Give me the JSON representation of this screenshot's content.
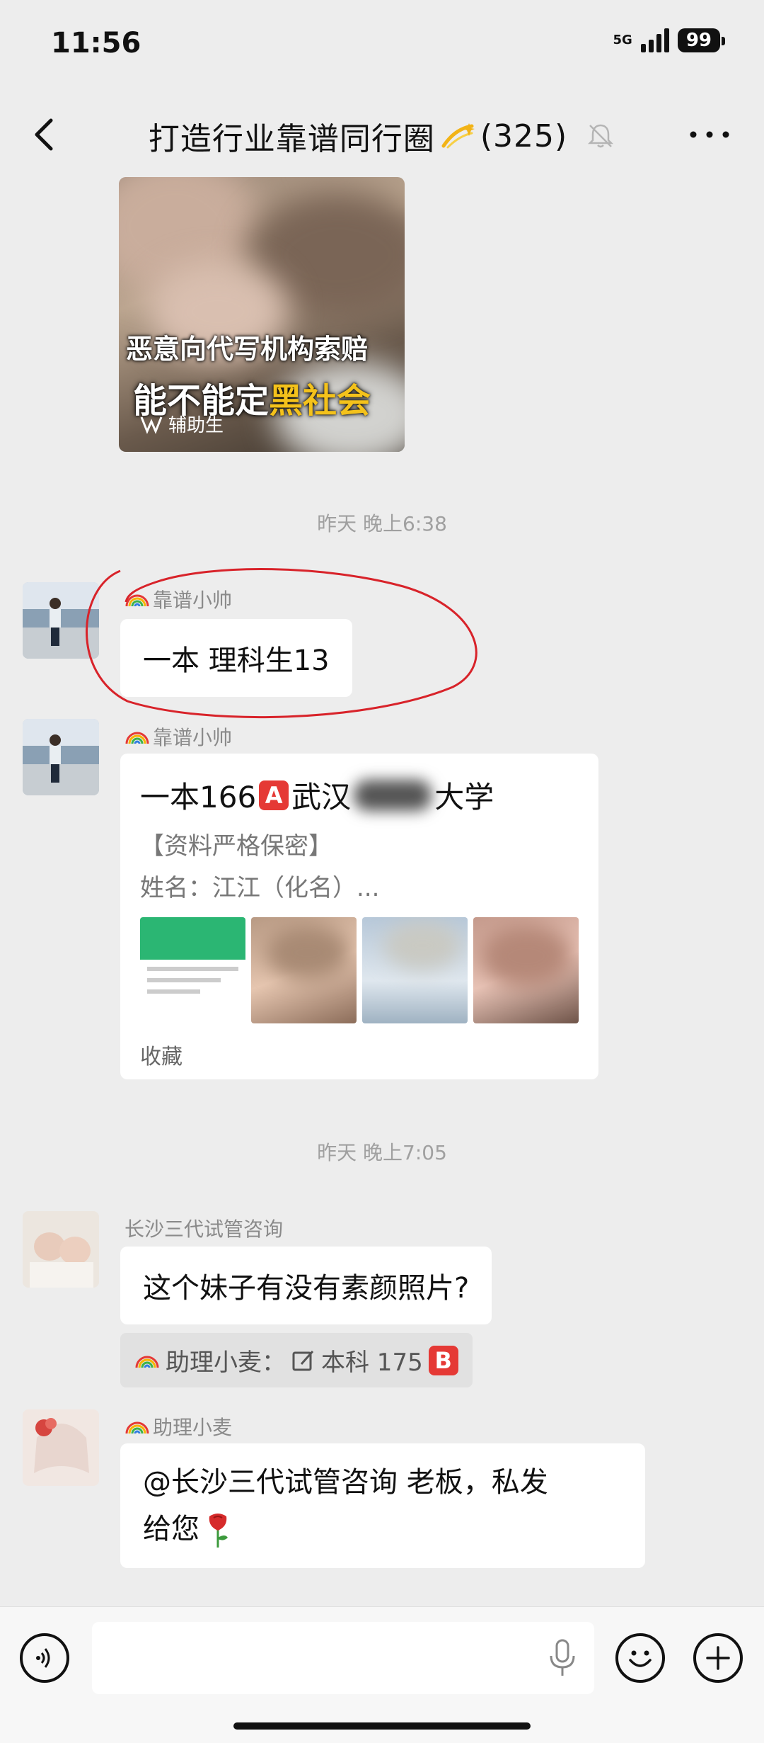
{
  "status": {
    "time": "11:56",
    "network": "5G",
    "battery": "99"
  },
  "header": {
    "title": "打造行业靠谱同行圈",
    "count": "(325)"
  },
  "media_card": {
    "caption_line1": "恶意向代写机构索赔",
    "caption_line2_a": "能不能",
    "caption_line2_b": "定",
    "caption_line2_c": "黑社会",
    "source": "辅助生"
  },
  "messages": {
    "time1": "昨天 晚上6:38",
    "msg1": {
      "sender": "靠谱小帅",
      "text": "一本 理科生13"
    },
    "msg2": {
      "sender": "靠谱小帅",
      "card_title_a": "一本166",
      "card_badge": "A",
      "card_title_b": "武汉",
      "card_title_c": "大学",
      "line1": "【资料严格保密】",
      "line2": "姓名：江江（化名）...",
      "footer": "收藏"
    },
    "time2": "昨天 晚上7:05",
    "msg3": {
      "sender": "长沙三代试管咨询",
      "text": "这个妹子有没有素颜照片?",
      "quote_sender": "助理小麦：",
      "quote_text": "本科 175",
      "quote_badge": "B"
    },
    "msg4": {
      "sender": "助理小麦",
      "text_line1": "@长沙三代试管咨询  老板，私发",
      "text_line2": "给您"
    }
  },
  "colors": {
    "background": "#ededed",
    "bubble": "#ffffff",
    "annotation": "#d8232a"
  }
}
